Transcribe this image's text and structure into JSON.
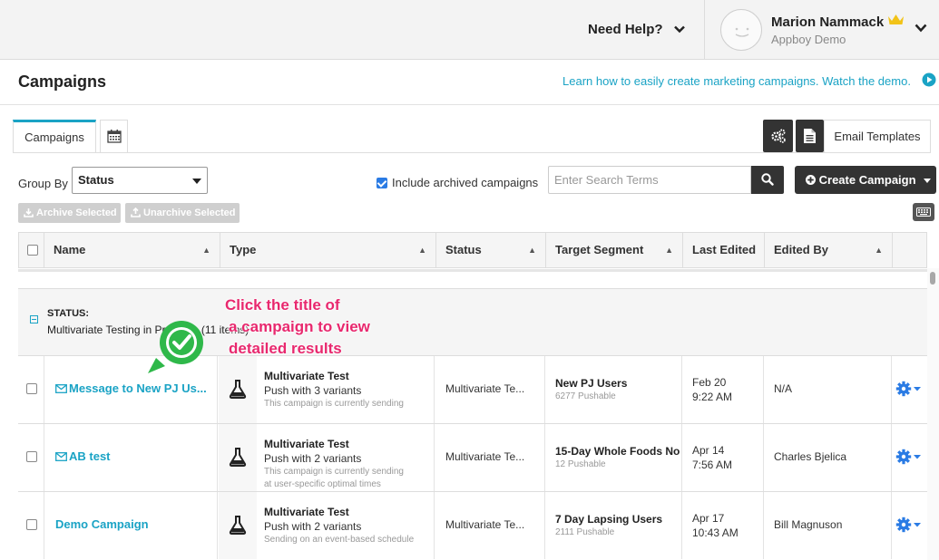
{
  "header": {
    "help_label": "Need Help?",
    "user_name": "Marion Nammack",
    "user_org": "Appboy Demo"
  },
  "page": {
    "title": "Campaigns",
    "learn_link": "Learn how to easily create marketing campaigns. Watch the demo."
  },
  "tabs": {
    "campaigns": "Campaigns",
    "email_templates": "Email Templates"
  },
  "controls": {
    "group_by_label": "Group By",
    "group_by_value": "Status",
    "include_archived_label": "Include archived campaigns",
    "include_archived_checked": true,
    "search_placeholder": "Enter Search Terms",
    "create_label": "Create Campaign",
    "archive_selected": "Archive Selected",
    "unarchive_selected": "Unarchive Selected"
  },
  "table": {
    "columns": [
      "Name",
      "Type",
      "Status",
      "Target Segment",
      "Last Edited",
      "Edited By"
    ],
    "group": {
      "label": "STATUS:",
      "value": "Multivariate Testing in Progress (11 items)"
    },
    "rows": [
      {
        "name": "Message to New PJ Us...",
        "has_mail_icon": true,
        "type_title": "Multivariate Test",
        "type_sub": "Push with 3 variants",
        "type_note": "This campaign is currently sending",
        "type_note2": "",
        "status": "Multivariate Te...",
        "segment": "New PJ Users",
        "segment_sub": "6277 Pushable",
        "edited_date": "Feb 20",
        "edited_time": "9:22 AM",
        "edited_by": "N/A"
      },
      {
        "name": "AB test",
        "has_mail_icon": true,
        "type_title": "Multivariate Test",
        "type_sub": "Push with 2 variants",
        "type_note": "This campaign is currently sending",
        "type_note2": "at user-specific optimal times",
        "status": "Multivariate Te...",
        "segment": "15-Day Whole Foods No",
        "segment_sub": "12 Pushable",
        "edited_date": "Apr 14",
        "edited_time": "7:56 AM",
        "edited_by": "Charles Bjelica"
      },
      {
        "name": "Demo Campaign",
        "has_mail_icon": false,
        "type_title": "Multivariate Test",
        "type_sub": "Push with 2 variants",
        "type_note": "Sending on an event-based schedule",
        "type_note2": "",
        "status": "Multivariate Te...",
        "segment": "7 Day Lapsing Users",
        "segment_sub": "2111 Pushable",
        "edited_date": "Apr 17",
        "edited_time": "10:43 AM",
        "edited_by": "Bill Magnuson"
      }
    ]
  },
  "annotation": {
    "line1": "Click the title of",
    "line2": "a campaign to view",
    "line3": "detailed results"
  },
  "colors": {
    "accent": "#1aa3c5",
    "dark_button": "#333333",
    "callout": "#e8286e",
    "badge_green": "#2fb84a",
    "gear_blue": "#2a7be4"
  }
}
